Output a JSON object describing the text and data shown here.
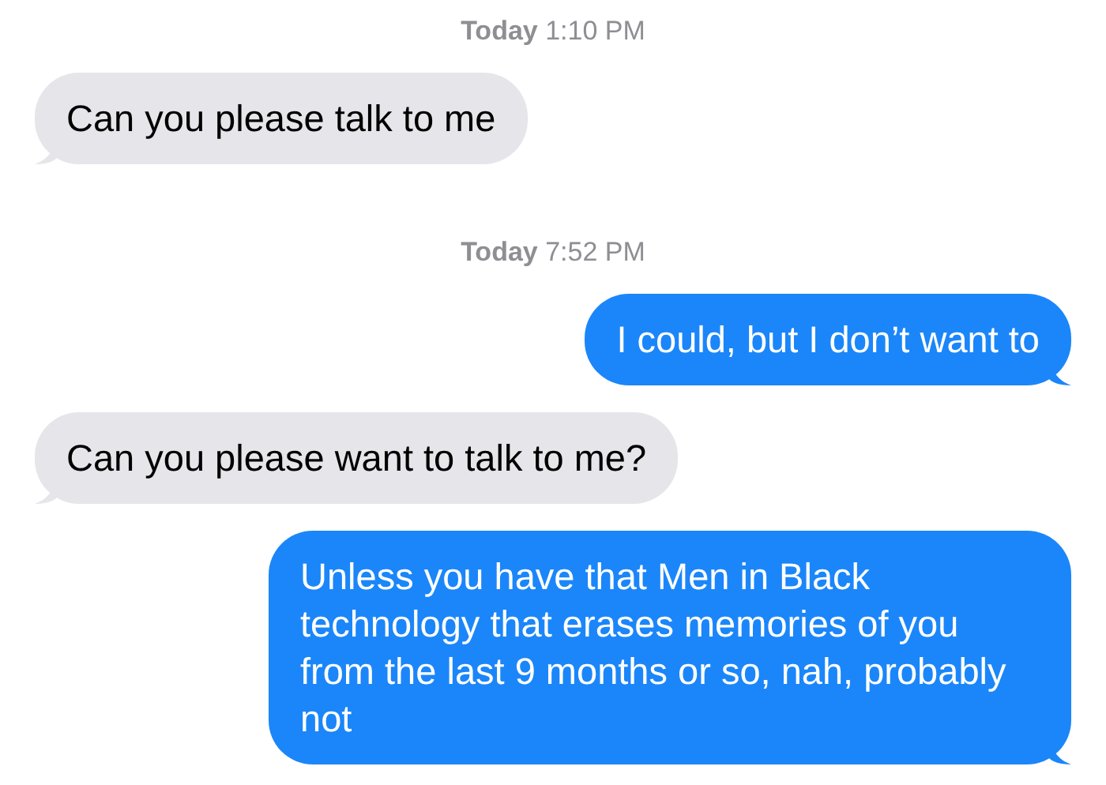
{
  "messages": [
    {
      "kind": "timestamp",
      "day": "Today",
      "time": "1:10 PM"
    },
    {
      "kind": "received",
      "text": "Can you please talk to me"
    },
    {
      "kind": "timestamp",
      "day": "Today",
      "time": "7:52 PM"
    },
    {
      "kind": "sent",
      "text": "I could, but I don’t want to"
    },
    {
      "kind": "received",
      "text": "Can you please want to talk to me?"
    },
    {
      "kind": "sent",
      "text": "Unless you have that Men in Black technology that erases memories of you from the last 9 months or so, nah, probably not"
    }
  ]
}
